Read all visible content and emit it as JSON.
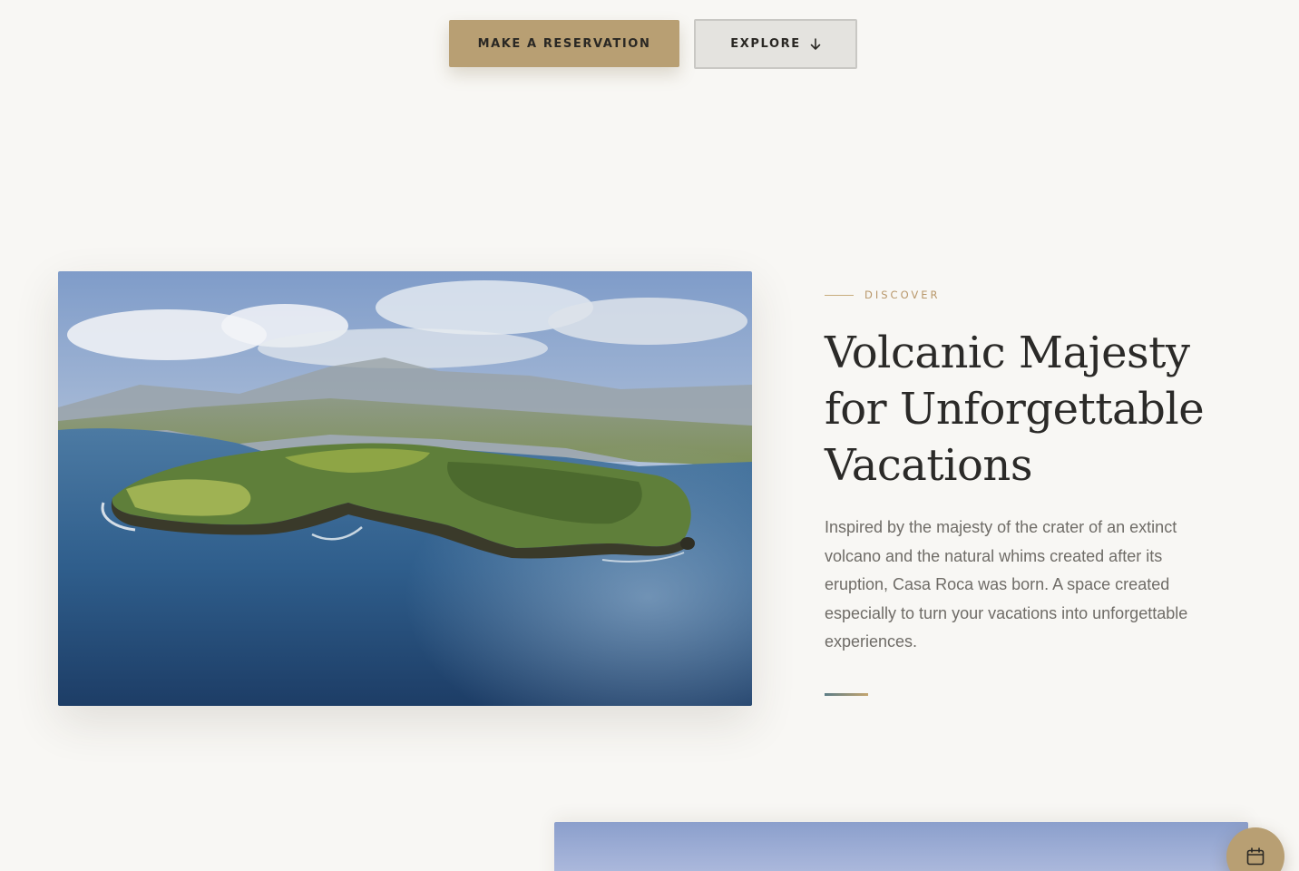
{
  "hero": {
    "reserve_label": "MAKE A RESERVATION",
    "explore_label": "EXPLORE",
    "explore_icon": "arrow-down-icon"
  },
  "feature": {
    "eyebrow": "DISCOVER",
    "headline": "Volcanic Majesty for Unforgettable Vacations",
    "body": "Inspired by the majesty of the crater of an extinct volcano and the natural whims created after its eruption, Casa Roca was born. A space created especially to turn your vacations into unforgettable experiences.",
    "image": "aerial-island-coast-photo"
  },
  "fab": {
    "icon": "calendar-icon"
  },
  "colors": {
    "background": "#f8f7f4",
    "accent_gold": "#b89f73",
    "text_dark": "#2b2a28",
    "text_muted": "#6f6c67"
  }
}
